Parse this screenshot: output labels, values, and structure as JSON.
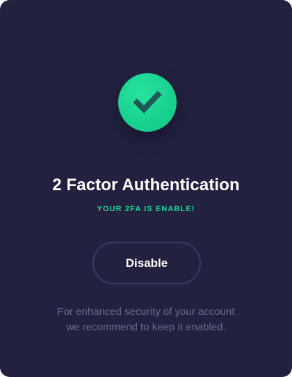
{
  "card": {
    "icon": "checkmark-icon",
    "title": "2 Factor Authentication",
    "status": "YOUR 2FA IS ENABLE!",
    "button_label": "Disable",
    "note_line1": "For enhanced security of your account",
    "note_line2": "we recommend to keep it enabled."
  },
  "colors": {
    "background": "#22213f",
    "accent": "#1fd89a",
    "muted_text": "#6c6b8c",
    "button_border": "#3b3a5e"
  }
}
